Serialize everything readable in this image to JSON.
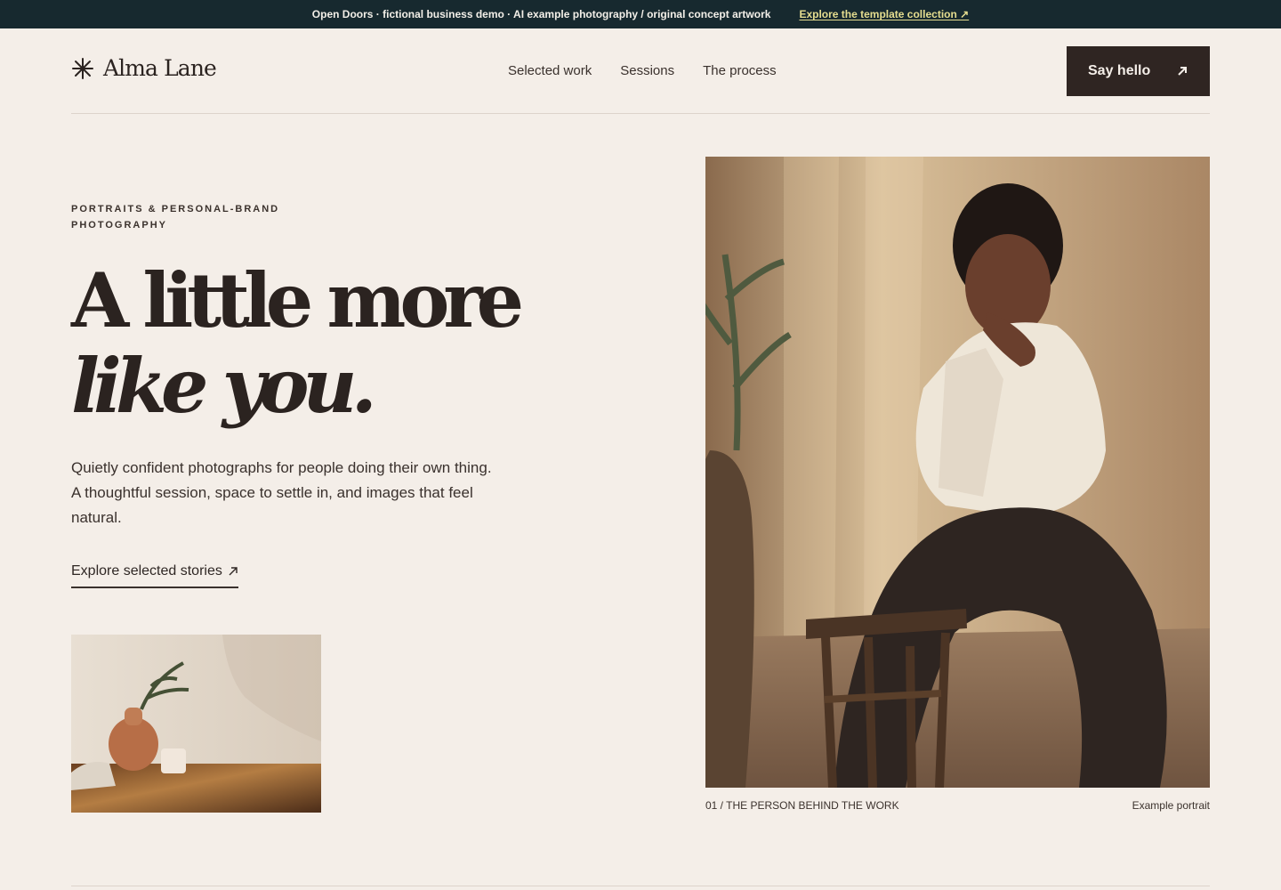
{
  "announcement": {
    "text": "Open Doors · fictional business demo · AI example photography / original concept artwork",
    "link": "Explore the template collection ↗"
  },
  "header": {
    "brand": "Alma Lane",
    "brand_icon": "asterisk-star-icon",
    "nav": [
      "Selected work",
      "Sessions",
      "The process"
    ],
    "cta": "Say hello",
    "cta_icon": "arrow-up-right-icon"
  },
  "hero": {
    "eyebrow": "PORTRAITS & PERSONAL-BRAND PHOTOGRAPHY",
    "headline_line1": "A little more",
    "headline_line2": "like you.",
    "intro": "Quietly confident photographs for people doing their own thing. A thoughtful session, space to settle in, and images that feel natural.",
    "link": "Explore selected stories",
    "link_icon": "arrow-up-right-icon"
  },
  "images": {
    "small": "still-life-vase-image",
    "main": "seated-portrait-image"
  },
  "captions": {
    "left": "01 / THE PERSON BEHIND THE WORK",
    "right": "Example portrait"
  },
  "colors": {
    "background": "#f4eee8",
    "announcement_bg": "#17292f",
    "announcement_link": "#e5dd8f",
    "primary_text": "#2b2320",
    "cta_bg": "#2f2522"
  }
}
